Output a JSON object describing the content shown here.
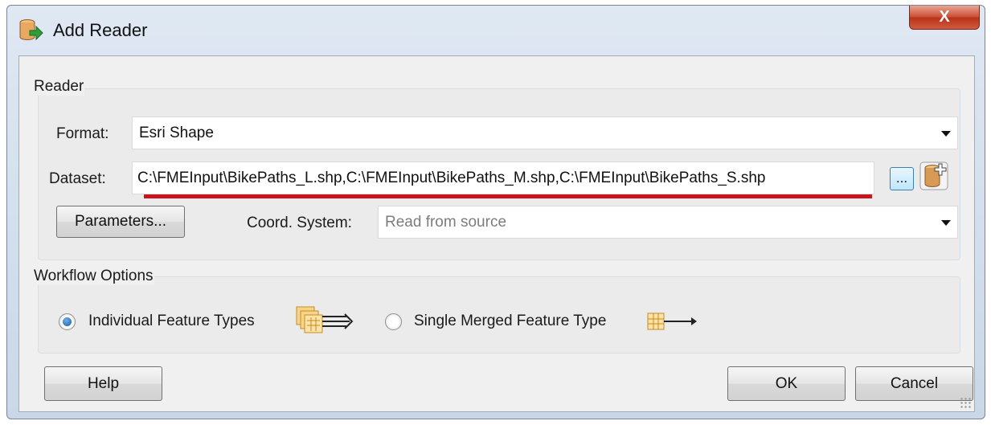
{
  "window": {
    "title": "Add Reader",
    "close_label": "X"
  },
  "reader": {
    "group_title": "Reader",
    "format_label": "Format:",
    "format_value": "Esri Shape",
    "dataset_label": "Dataset:",
    "dataset_value": "C:\\FMEInput\\BikePaths_L.shp,C:\\FMEInput\\BikePaths_M.shp,C:\\FMEInput\\BikePaths_S.shp",
    "browse_label": "...",
    "parameters_label": "Parameters...",
    "coord_label": "Coord. System:",
    "coord_placeholder": "Read from source"
  },
  "workflow": {
    "group_title": "Workflow Options",
    "individual_label": "Individual Feature Types",
    "single_label": "Single Merged Feature Type",
    "selected": "individual"
  },
  "buttons": {
    "help": "Help",
    "ok": "OK",
    "cancel": "Cancel"
  },
  "colors": {
    "highlight_underline": "#c8141d",
    "close_button": "#cd4f35",
    "radio_selected": "#1a5a9e"
  },
  "icons": {
    "title": "add-reader-icon",
    "browse": "browse-icon",
    "add_dataset": "add-dataset-icon",
    "individual": "multiple-feature-types-icon",
    "single": "single-feature-type-icon"
  }
}
